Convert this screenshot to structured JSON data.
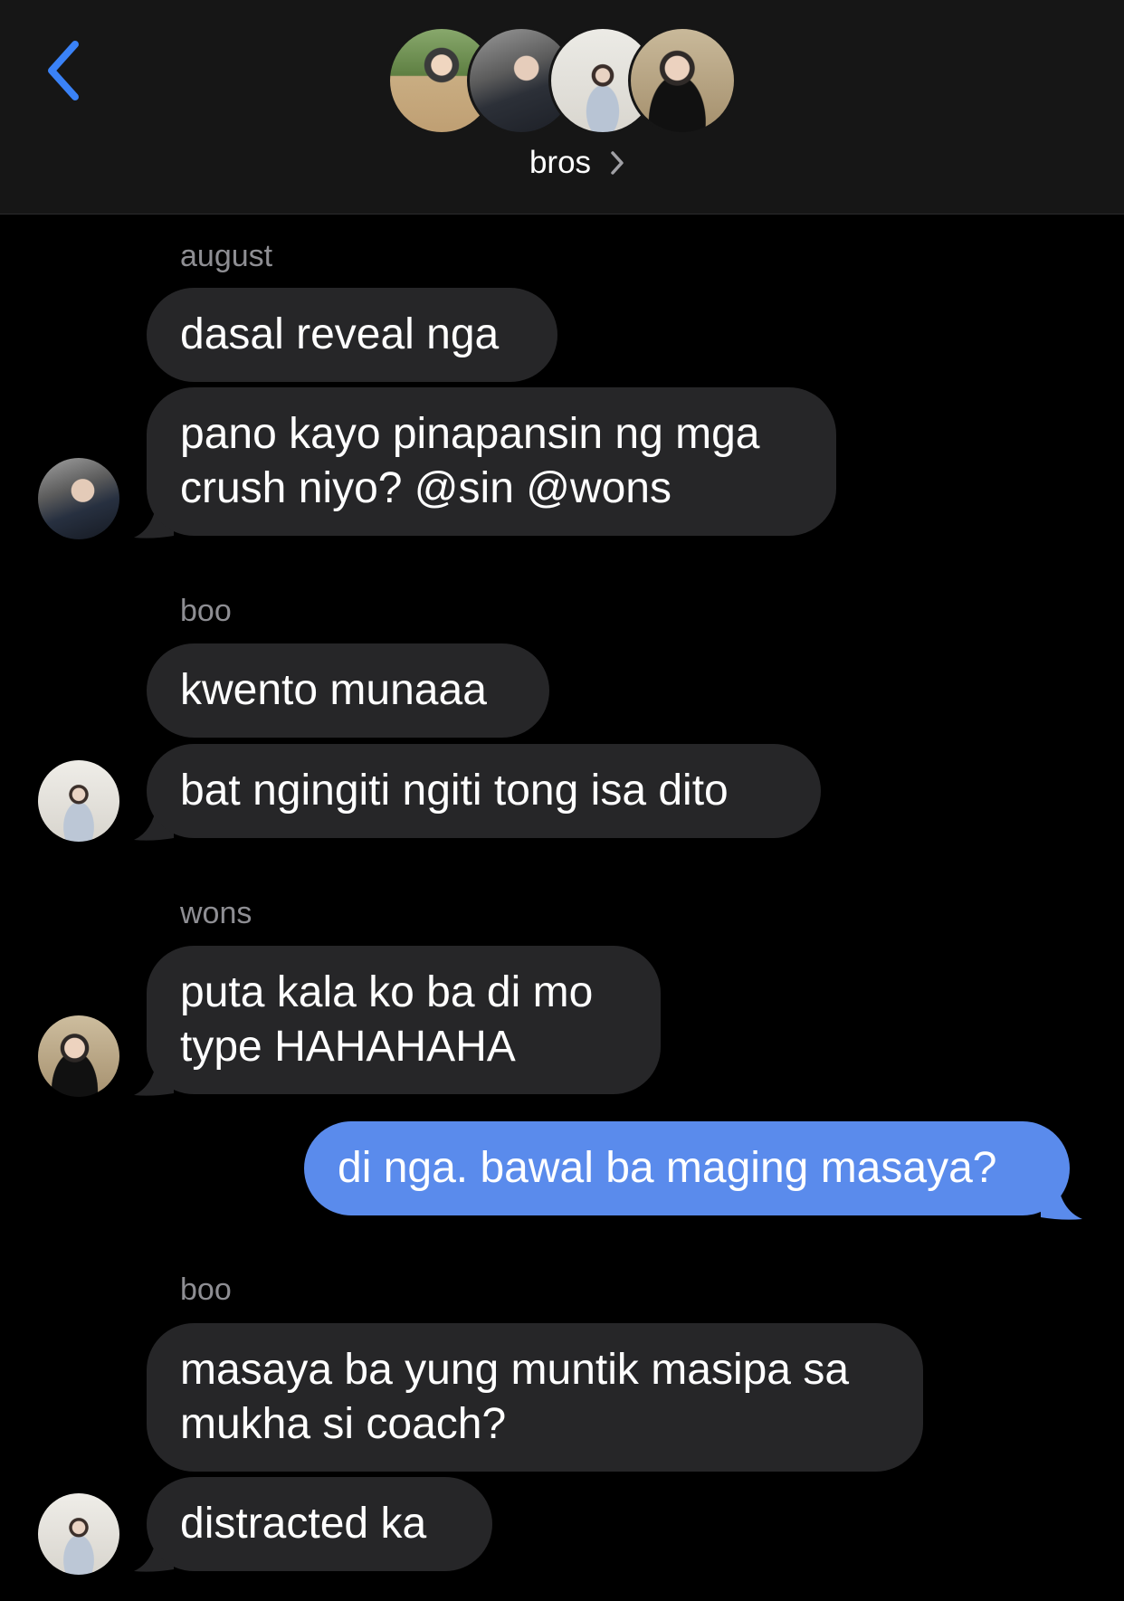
{
  "header": {
    "title": "bros",
    "back_icon": "chevron-left-icon",
    "info_icon": "chevron-right-icon",
    "accent_color": "#3a82f7"
  },
  "messages": [
    {
      "sender": "august",
      "bubbles": [
        "dasal reveal nga",
        "pano kayo pinapansin ng mga\ncrush niyo? @sin @wons"
      ]
    },
    {
      "sender": "boo",
      "bubbles": [
        "kwento munaaa",
        "bat ngingiti ngiti tong isa dito"
      ]
    },
    {
      "sender": "wons",
      "bubbles": [
        "puta kala ko ba di mo\ntype HAHAHAHA"
      ]
    },
    {
      "sender": "me",
      "bubbles": [
        "di nga. bawal ba maging masaya?"
      ]
    },
    {
      "sender": "boo",
      "bubbles": [
        "masaya ba yung muntik masipa sa\nmukha si coach?",
        "distracted ka"
      ]
    }
  ],
  "colors": {
    "incoming_bubble": "#262628",
    "outgoing_bubble": "#5a8bec",
    "sender_label": "#8e8e93"
  }
}
